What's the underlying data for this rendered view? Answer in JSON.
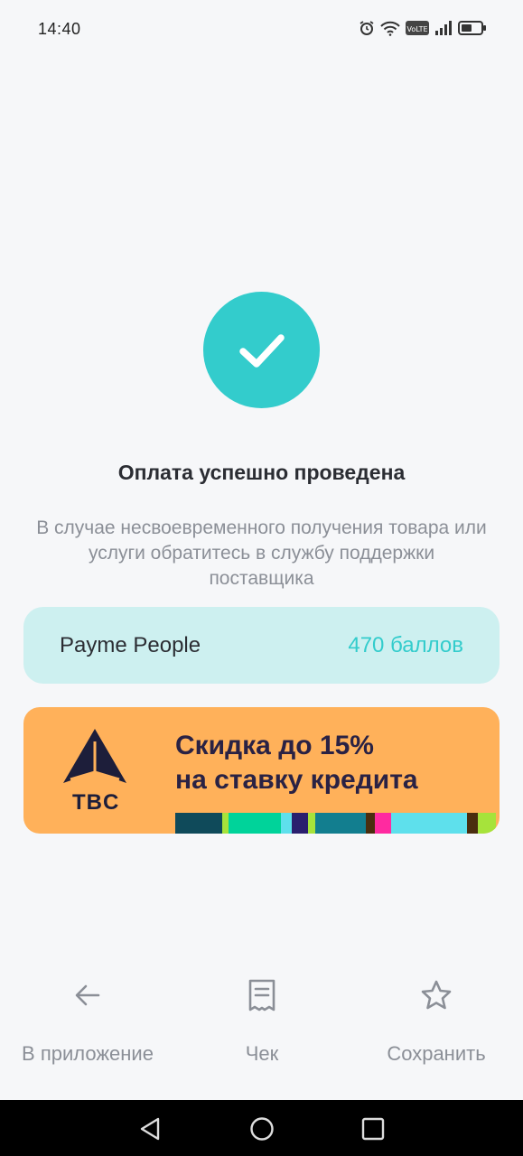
{
  "status_bar": {
    "time": "14:40",
    "icons": [
      "alarm-icon",
      "wifi-icon",
      "volte-icon",
      "signal-icon",
      "battery-icon"
    ],
    "volte_label": "VoLTE"
  },
  "result": {
    "icon": "check-icon",
    "title": "Оплата успешно проведена",
    "subtitle": "В случае несвоевременного получения товара или услуги обратитесь в службу поддержки поставщика"
  },
  "points": {
    "name": "Payme People",
    "value": "470 баллов"
  },
  "banner": {
    "logo_text": "TBC",
    "line1": "Скидка до 15%",
    "line2": "на ставку кредита"
  },
  "actions": [
    {
      "icon": "arrow-left-icon",
      "label": "В приложение"
    },
    {
      "icon": "receipt-icon",
      "label": "Чек"
    },
    {
      "icon": "star-icon",
      "label": "Сохранить"
    }
  ],
  "colors": {
    "accent": "#33cccc",
    "card_bg": "#cdf0f0",
    "banner_bg": "#ffb15a",
    "background": "#f6f7f9"
  }
}
